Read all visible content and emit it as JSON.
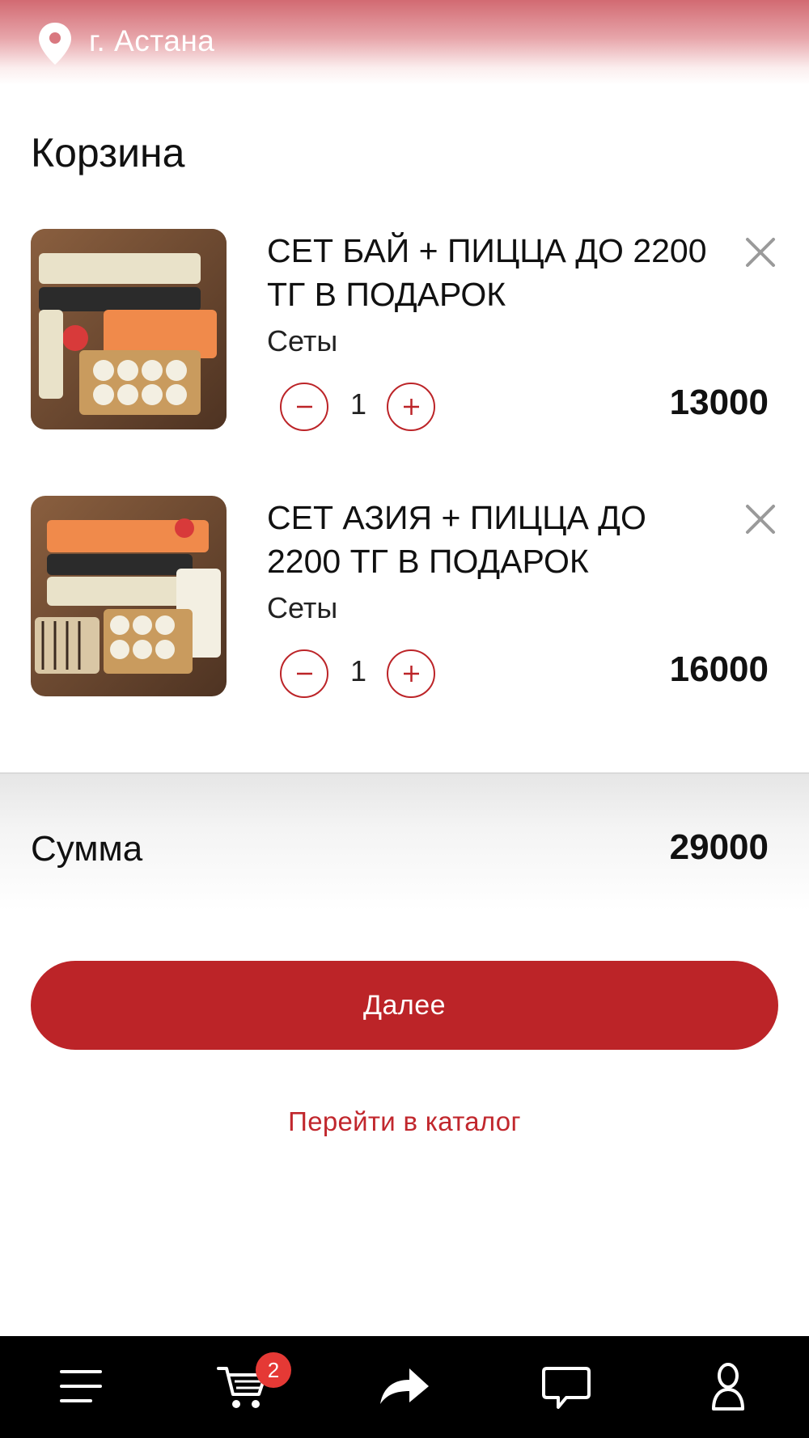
{
  "header": {
    "city": "г. Астана",
    "icon": "location-pin-icon"
  },
  "page": {
    "title": "Корзина"
  },
  "cart": {
    "items": [
      {
        "name": "СЕТ БАЙ + ПИЦЦА ДО 2200 ТГ В ПОДАРОК",
        "category": "Сеты",
        "quantity": "1",
        "price": "13000"
      },
      {
        "name": "СЕТ АЗИЯ + ПИЦЦА ДО 2200 ТГ В ПОДАРОК",
        "category": "Сеты",
        "quantity": "1",
        "price": "16000"
      }
    ]
  },
  "summary": {
    "label": "Сумма",
    "total": "29000"
  },
  "actions": {
    "next_label": "Далее",
    "catalog_label": "Перейти в каталог"
  },
  "bottom_nav": {
    "cart_badge": "2",
    "icons": [
      "menu-icon",
      "cart-icon",
      "share-icon",
      "chat-icon",
      "profile-icon"
    ]
  },
  "colors": {
    "accent": "#bc2428",
    "badge": "#e53935",
    "nav_bg": "#000000"
  }
}
